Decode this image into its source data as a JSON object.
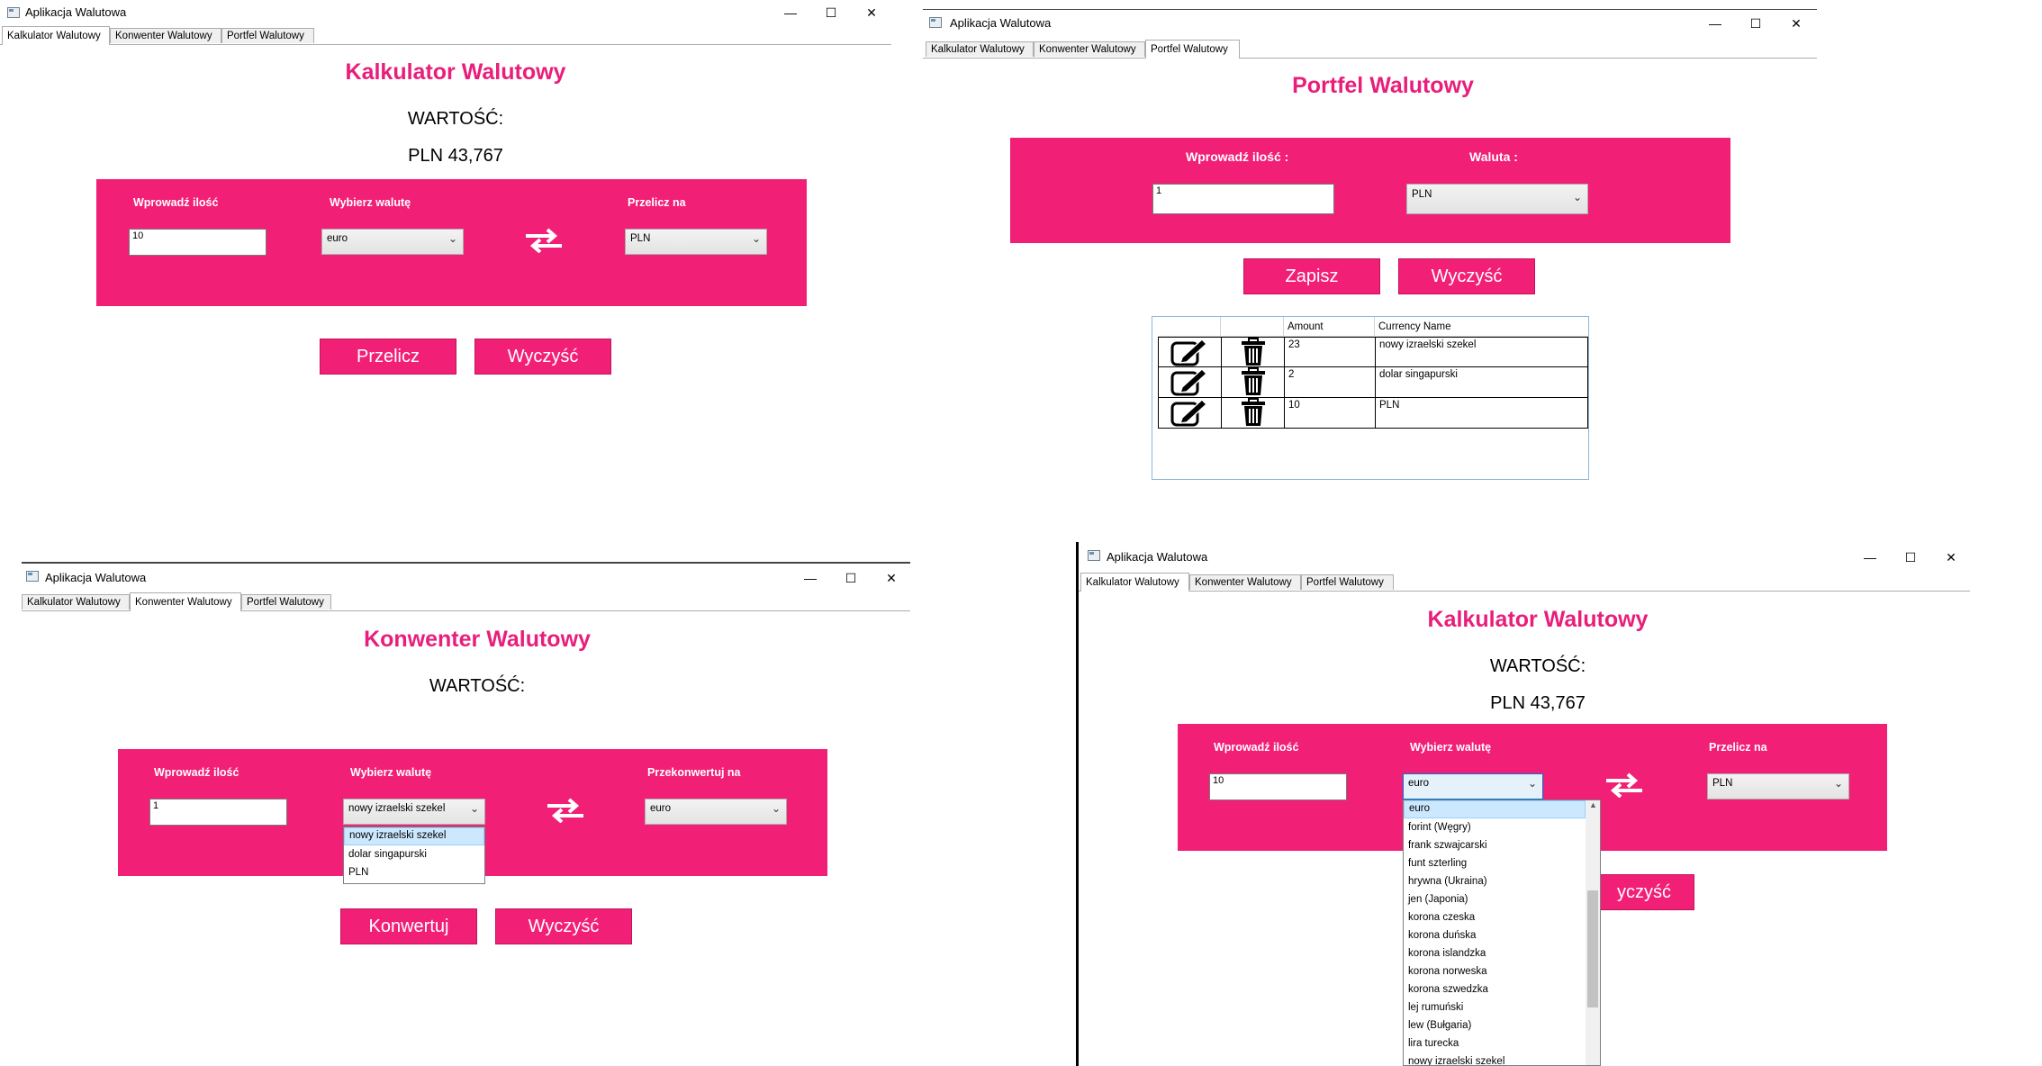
{
  "app_title": "Aplikacja Walutowa",
  "tabs": [
    "Kalkulator Walutowy",
    "Konwenter Walutowy",
    "Portfel Walutowy"
  ],
  "window_controls": {
    "minimize": "—",
    "maximize": "☐",
    "close": "✕"
  },
  "calculator": {
    "heading": "Kalkulator Walutowy",
    "value_label": "WARTOŚĆ:",
    "result": "PLN 43,767",
    "amount_label": "Wprowadź ilość",
    "amount_value": "10",
    "from_label": "Wybierz walutę",
    "from_value": "euro",
    "to_label": "Przelicz na",
    "to_value": "PLN",
    "calc_button": "Przelicz",
    "clear_button": "Wyczyść",
    "clear_button_partial": "yczyść"
  },
  "converter": {
    "heading": "Konwenter Walutowy",
    "value_label": "WARTOŚĆ:",
    "amount_label": "Wprowadź ilość",
    "amount_value": "1",
    "from_label": "Wybierz walutę",
    "from_value": "nowy izraelski szekel",
    "to_label": "Przekonwertuj na",
    "to_value": "euro",
    "dropdown_options": [
      "nowy izraelski szekel",
      "dolar singapurski",
      "PLN"
    ],
    "convert_button": "Konwertuj",
    "clear_button": "Wyczyść"
  },
  "wallet": {
    "heading": "Portfel Walutowy",
    "amount_label": "Wprowadź ilość :",
    "amount_value": "1",
    "currency_label": "Waluta :",
    "currency_value": "PLN",
    "save_button": "Zapisz",
    "clear_button": "Wyczyść",
    "columns": [
      "",
      "",
      "Amount",
      "Currency Name"
    ],
    "rows": [
      {
        "amount": "23",
        "currency": "nowy izraelski szekel"
      },
      {
        "amount": "2",
        "currency": "dolar singapurski"
      },
      {
        "amount": "10",
        "currency": "PLN"
      }
    ]
  },
  "calculator_dropdown": [
    "euro",
    "forint (Węgry)",
    "frank szwajcarski",
    "funt szterling",
    "hrywna (Ukraina)",
    "jen (Japonia)",
    "korona czeska",
    "korona duńska",
    "korona islandzka",
    "korona norweska",
    "korona szwedzka",
    "lej rumuński",
    "lew (Bułgaria)",
    "lira turecka",
    "nowy izraelski szekel"
  ],
  "colors": {
    "accent": "#f21f76",
    "heading": "#e91e7a"
  }
}
